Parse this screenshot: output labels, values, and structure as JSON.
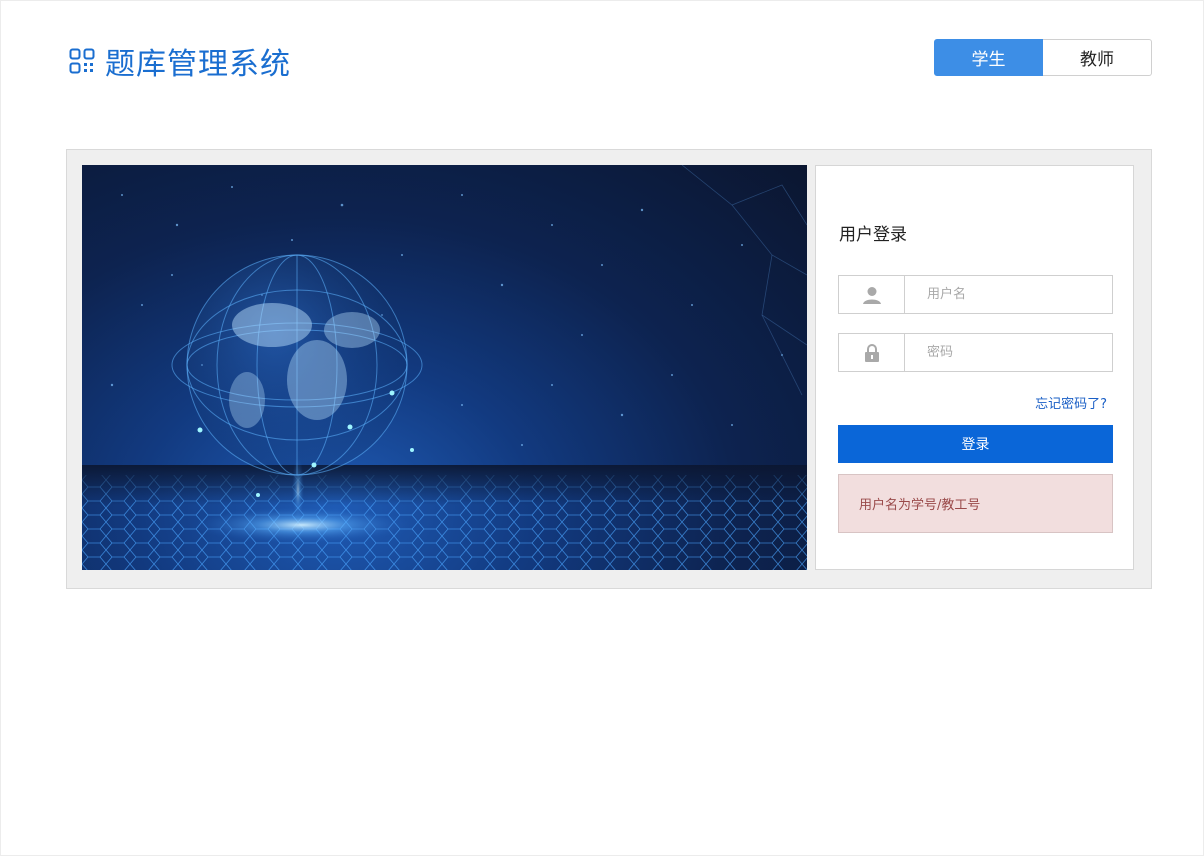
{
  "header": {
    "title": "题库管理系统",
    "logo_icon": "grid-logo-icon",
    "accent_color": "#1a6ed0"
  },
  "role_switch": {
    "student_label": "学生",
    "teacher_label": "教师",
    "selected": "学生"
  },
  "login": {
    "title": "用户登录",
    "username": {
      "placeholder": "用户名",
      "value": "",
      "icon": "user-icon"
    },
    "password": {
      "placeholder": "密码",
      "value": "",
      "icon": "lock-icon"
    },
    "forgot_label": "忘记密码了?",
    "submit_label": "登录",
    "hint_text": "用户名为学号/教工号",
    "button_color": "#0a66d8",
    "hint_background": "#f2dede"
  },
  "hero": {
    "image": "digital-globe-illustration"
  }
}
